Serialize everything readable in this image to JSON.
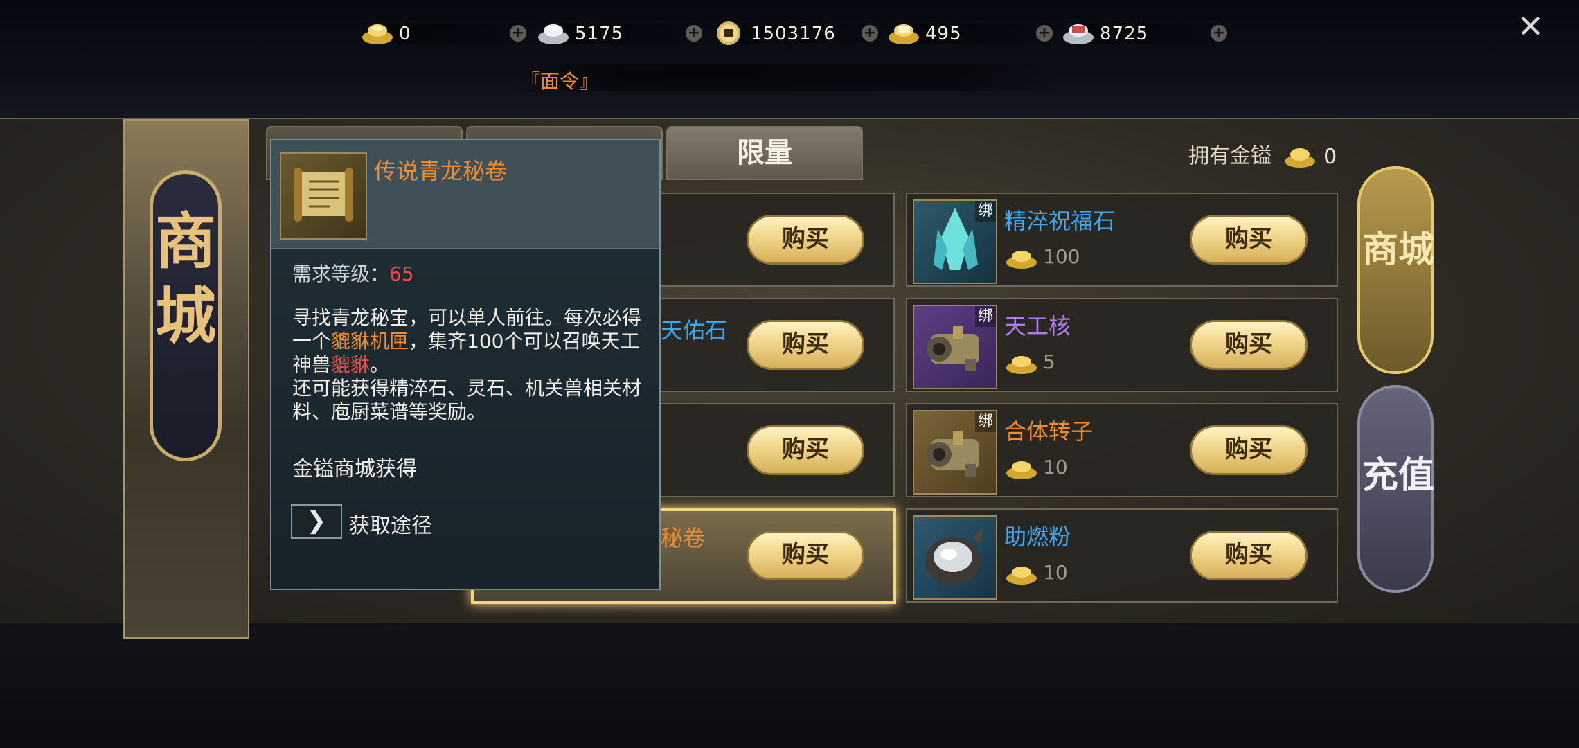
{
  "currencies": [
    {
      "icon": "gold-ingot-icon",
      "value": "0"
    },
    {
      "icon": "silver-ingot-icon",
      "value": "5175"
    },
    {
      "icon": "copper-coin-icon",
      "value": "1503176"
    },
    {
      "icon": "gold-ticket-ingot-icon",
      "value": "495"
    },
    {
      "icon": "silver-ticket-ingot-icon",
      "value": "8725"
    }
  ],
  "notice_text": "『面令』",
  "left_banner_title": "商城",
  "tabs": {
    "limited": "限量"
  },
  "owned": {
    "label": "拥有金镒",
    "value": "0"
  },
  "buy_label": "购买",
  "left_items": [
    {
      "partial_name": "",
      "color": "#3fa6f2"
    },
    {
      "partial_name": "天佑石",
      "color": "#3fa6f2"
    },
    {
      "partial_name": "",
      "color": "#3fa6f2"
    },
    {
      "partial_name": "秘卷",
      "color": "#f28c2c"
    }
  ],
  "right_items": [
    {
      "name": "精淬祝福石",
      "price": "100",
      "bind": "绑",
      "color": "#3fa6f2",
      "icon": "crystal-icon"
    },
    {
      "name": "天工核",
      "price": "5",
      "bind": "绑",
      "color": "#b07cf0",
      "icon": "mechanism-core-icon"
    },
    {
      "name": "合体转子",
      "price": "10",
      "bind": "绑",
      "color": "#f28c2c",
      "icon": "rotor-icon"
    },
    {
      "name": "助燃粉",
      "price": "10",
      "bind": "",
      "color": "#3fa6f2",
      "icon": "powder-pouch-icon"
    }
  ],
  "side_tabs": {
    "shop": "商城",
    "recharge": "充值"
  },
  "tooltip": {
    "item_name": "传说青龙秘卷",
    "level_label": "需求等级：",
    "level_value": "65",
    "desc_part1": "寻找青龙秘宝，可以单人前往。每次必得一个",
    "desc_highlight1": "貔貅机匣",
    "desc_part2": "，集齐100个可以召唤天工神兽",
    "desc_highlight2": "貔貅",
    "desc_part3": "。",
    "desc_line2": "还可能获得精淬石、灵石、机关兽相关材料、庖厨菜谱等奖励。",
    "source": "金镒商城获得",
    "route_label": "获取途径"
  }
}
